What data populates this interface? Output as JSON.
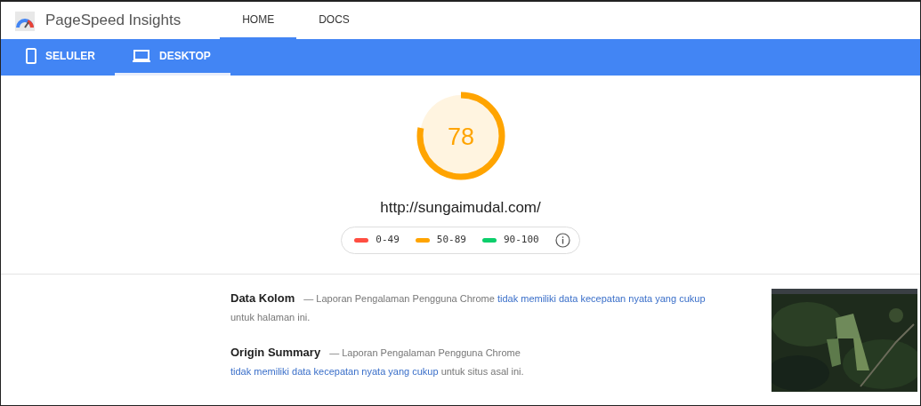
{
  "header": {
    "title": "PageSpeed Insights",
    "tabs": [
      {
        "label": "HOME",
        "selected": true
      },
      {
        "label": "DOCS",
        "selected": false
      }
    ]
  },
  "device_tabs": [
    {
      "label": "SELULER",
      "kind": "mobile",
      "selected": false
    },
    {
      "label": "DESKTOP",
      "kind": "desktop",
      "selected": true
    }
  ],
  "score": {
    "value": "78",
    "level": 0.78
  },
  "url": "http://sungaimudal.com/",
  "legend": [
    {
      "range": "0-49",
      "color": "#ff4e42"
    },
    {
      "range": "50-89",
      "color": "#ffa400"
    },
    {
      "range": "90-100",
      "color": "#0cce6b"
    }
  ],
  "sections": [
    {
      "title": "Data Kolom",
      "text": "— Laporan Pengalaman Pengguna Chrome",
      "link": "tidak memiliki data kecepatan nyata yang cukup",
      "after": "untuk halaman ini."
    },
    {
      "title": "Origin Summary",
      "text": "— Laporan Pengalaman Pengguna Chrome",
      "link": "tidak memiliki data kecepatan nyata yang cukup",
      "after": "untuk situs asal ini."
    }
  ]
}
